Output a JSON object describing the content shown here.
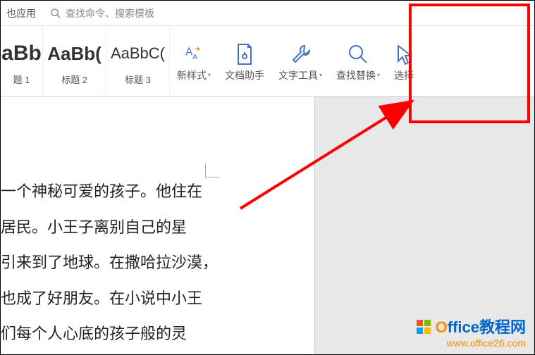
{
  "topbar": {
    "app_label": "也应用",
    "search_placeholder": "查找命令、搜索模板"
  },
  "styles": [
    {
      "preview": "aBb",
      "label": "题 1",
      "size": "30px",
      "bold": true
    },
    {
      "preview": "AaBb(",
      "label": "标题 2",
      "size": "26px",
      "bold": true
    },
    {
      "preview": "AaBbC(",
      "label": "标题 3",
      "size": "22px",
      "bold": false
    }
  ],
  "ribbon": {
    "new_style": "新样式",
    "doc_helper": "文档助手",
    "text_tools": "文字工具",
    "find_replace": "查找替换",
    "select": "选择"
  },
  "document": {
    "lines": [
      "一个神秘可爱的孩子。他住在",
      "居民。小王子离别自己的星",
      "引来到了地球。在撒哈拉沙漠，",
      "也成了好朋友。在小说中小王",
      "们每个人心底的孩子般的灵"
    ]
  },
  "watermark": {
    "brand_prefix": "O",
    "brand_rest": "ffice教程网",
    "url": "www.office26.com"
  }
}
